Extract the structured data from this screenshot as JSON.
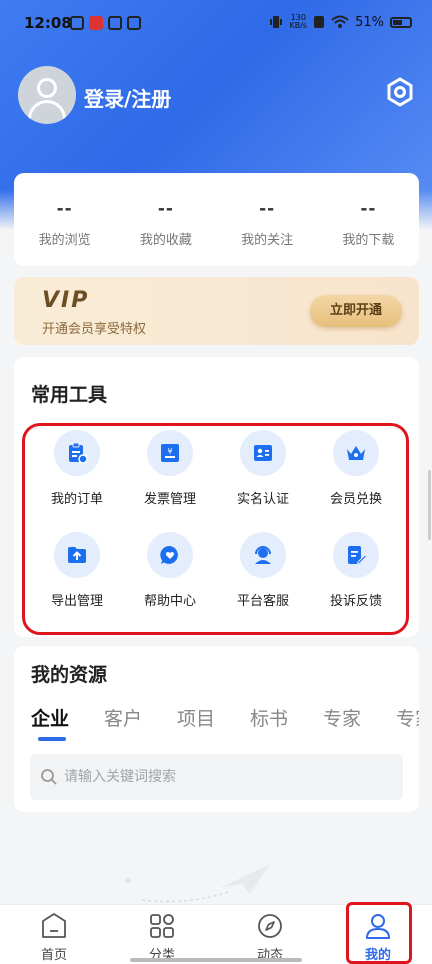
{
  "status_bar": {
    "time": "12:08",
    "net_speed_top": "130",
    "net_speed_bottom": "KB/s",
    "battery": "51%"
  },
  "profile": {
    "login_text": "登录/注册"
  },
  "stats": [
    {
      "value": "--",
      "label": "我的浏览"
    },
    {
      "value": "--",
      "label": "我的收藏"
    },
    {
      "value": "--",
      "label": "我的关注"
    },
    {
      "value": "--",
      "label": "我的下载"
    }
  ],
  "vip": {
    "title": "VIP",
    "subtitle": "开通会员享受特权",
    "button": "立即开通"
  },
  "tools": {
    "title": "常用工具",
    "items": [
      {
        "label": "我的订单",
        "icon": "clipboard-icon"
      },
      {
        "label": "发票管理",
        "icon": "invoice-icon"
      },
      {
        "label": "实名认证",
        "icon": "id-card-icon"
      },
      {
        "label": "会员兑换",
        "icon": "crown-icon"
      },
      {
        "label": "导出管理",
        "icon": "folder-upload-icon"
      },
      {
        "label": "帮助中心",
        "icon": "chat-heart-icon"
      },
      {
        "label": "平台客服",
        "icon": "headset-icon"
      },
      {
        "label": "投诉反馈",
        "icon": "edit-doc-icon"
      }
    ]
  },
  "resources": {
    "title": "我的资源",
    "tabs": [
      "企业",
      "客户",
      "项目",
      "标书",
      "专家",
      "专家"
    ],
    "active_tab": 0,
    "search_placeholder": "请输入关键词搜索"
  },
  "bottom_nav": [
    {
      "label": "首页",
      "icon": "home-icon"
    },
    {
      "label": "分类",
      "icon": "grid-icon"
    },
    {
      "label": "动态",
      "icon": "compass-icon"
    },
    {
      "label": "我的",
      "icon": "person-icon"
    }
  ],
  "colors": {
    "primary": "#2f6ae8",
    "highlight": "#e0141e",
    "vip_gold": "#e7bf7c"
  }
}
